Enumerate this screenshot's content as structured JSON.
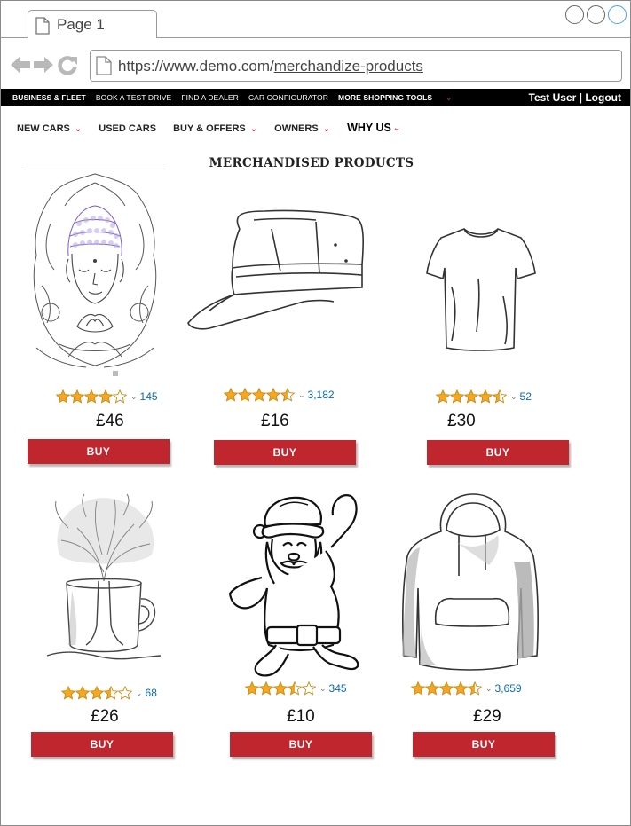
{
  "browser": {
    "tab_title": "Page 1",
    "url_base": "https://www.demo.com/",
    "url_path": "merchandize-products"
  },
  "topbar": {
    "links": [
      "BUSINESS & FLEET",
      "BOOK A TEST DRIVE",
      "FIND A DEALER",
      "CAR CONFIGURATOR",
      "MORE SHOPPING TOOLS"
    ],
    "user": "Test User | Logout"
  },
  "mainnav": {
    "items": [
      "NEW CARS",
      "USED CARS",
      "BUY & OFFERS",
      "OWNERS",
      "WHY US"
    ]
  },
  "page": {
    "heading": "MERCHANDISED PRODUCTS",
    "buy_label": "BUY"
  },
  "products": [
    {
      "image": "buddha-mandala",
      "rating": 4,
      "reviews": "145",
      "price": "£46"
    },
    {
      "image": "cap",
      "rating": 4.5,
      "reviews": "3,182",
      "price": "£16"
    },
    {
      "image": "t-shirt",
      "rating": 4.5,
      "reviews": "52",
      "price": "£30"
    },
    {
      "image": "tree-in-mug",
      "rating": 3.5,
      "reviews": "68",
      "price": "£26"
    },
    {
      "image": "santa-claus",
      "rating": 3.5,
      "reviews": "345",
      "price": "£10"
    },
    {
      "image": "hoodie",
      "rating": 4.5,
      "reviews": "3,659",
      "price": "£29"
    }
  ],
  "colors": {
    "brand_red": "#c0262d",
    "star_gold": "#f5a623",
    "link_blue": "#0a6ab5"
  }
}
